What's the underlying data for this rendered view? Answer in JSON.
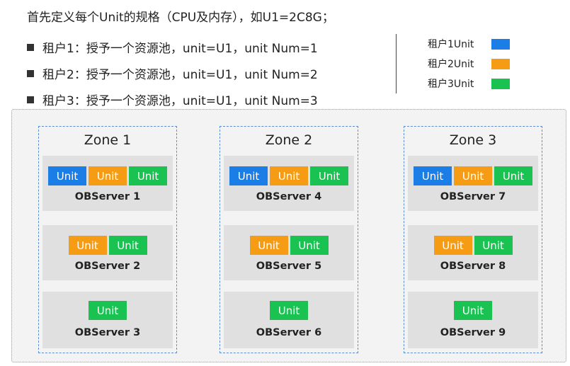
{
  "title": "首先定义每个Unit的规格（CPU及内存），如U1=2C8G；",
  "bullets": [
    "租户1：授予一个资源池，unit=U1，unit Num=1",
    "租户2：授予一个资源池，unit=U1，unit Num=2",
    "租户3：授予一个资源池，unit=U1，unit Num=3"
  ],
  "legend": [
    {
      "label": "租户1Unit",
      "color": "#1a7ee6"
    },
    {
      "label": "租户2Unit",
      "color": "#f59c14"
    },
    {
      "label": "租户3Unit",
      "color": "#1ac251"
    }
  ],
  "unit_label": "Unit",
  "zones": [
    {
      "name": "Zone 1",
      "servers": [
        {
          "name": "OBServer 1",
          "units": [
            "tenant1",
            "tenant2",
            "tenant3"
          ]
        },
        {
          "name": "OBServer 2",
          "units": [
            "tenant2",
            "tenant3"
          ]
        },
        {
          "name": "OBServer 3",
          "units": [
            "tenant3"
          ]
        }
      ]
    },
    {
      "name": "Zone 2",
      "servers": [
        {
          "name": "OBServer 4",
          "units": [
            "tenant1",
            "tenant2",
            "tenant3"
          ]
        },
        {
          "name": "OBServer 5",
          "units": [
            "tenant2",
            "tenant3"
          ]
        },
        {
          "name": "OBServer 6",
          "units": [
            "tenant3"
          ]
        }
      ]
    },
    {
      "name": "Zone 3",
      "servers": [
        {
          "name": "OBServer 7",
          "units": [
            "tenant1",
            "tenant2",
            "tenant3"
          ]
        },
        {
          "name": "OBServer 8",
          "units": [
            "tenant2",
            "tenant3"
          ]
        },
        {
          "name": "OBServer 9",
          "units": [
            "tenant3"
          ]
        }
      ]
    }
  ],
  "colors": {
    "tenant1": "#1a7ee6",
    "tenant2": "#f59c14",
    "tenant3": "#1ac251"
  }
}
